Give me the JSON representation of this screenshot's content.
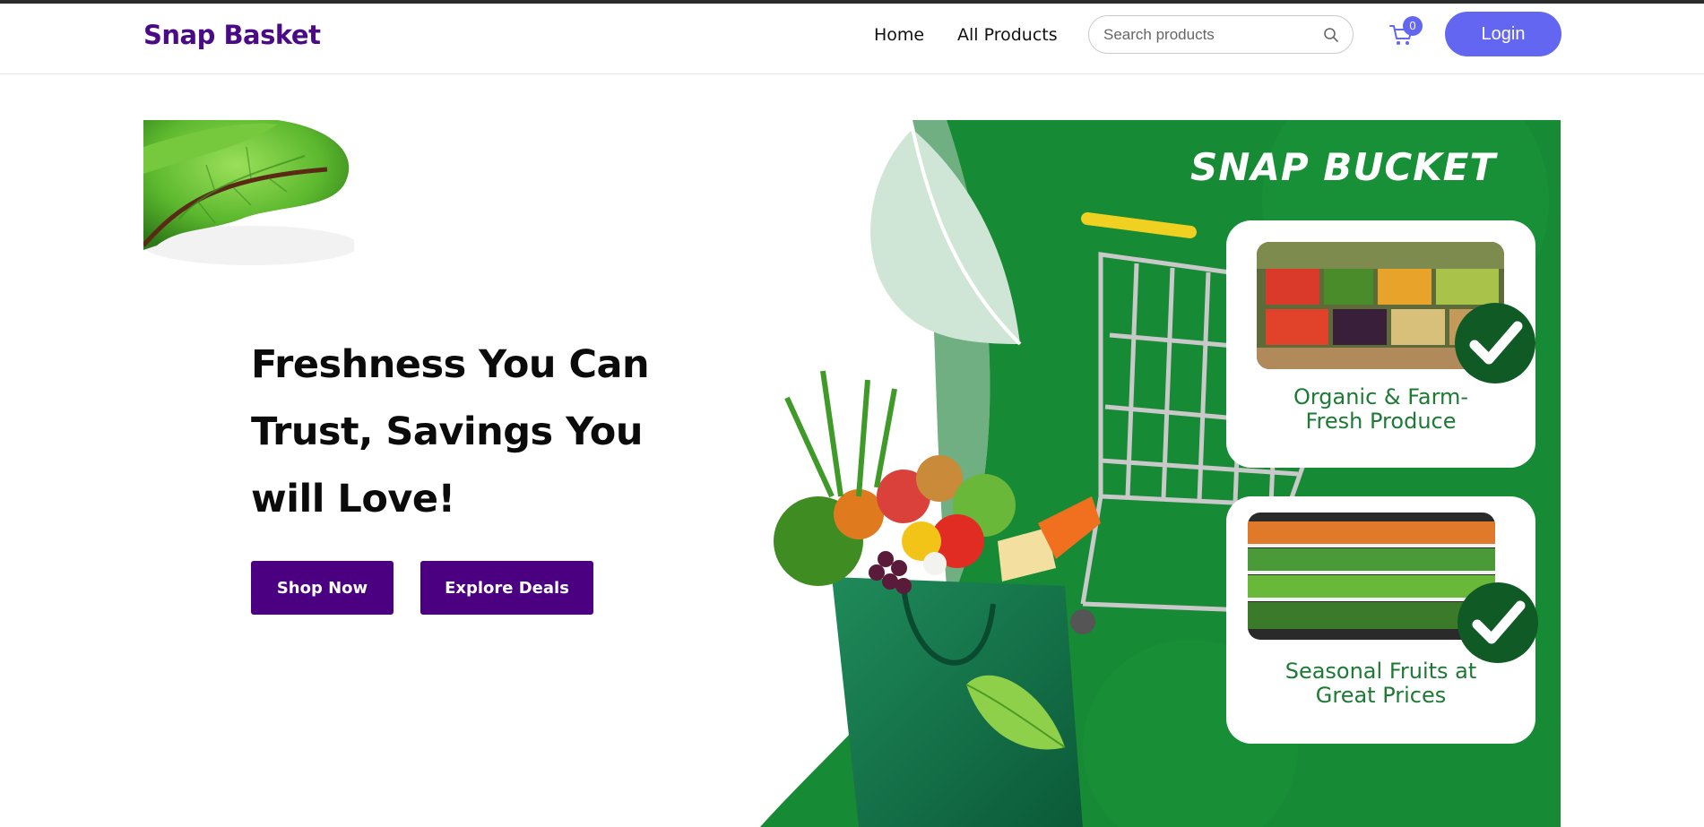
{
  "header": {
    "logo": "Snap Basket",
    "nav": {
      "home": "Home",
      "all_products": "All Products"
    },
    "search": {
      "placeholder": "Search products",
      "value": ""
    },
    "cart_count": "0",
    "login_label": "Login"
  },
  "hero": {
    "title_lines": [
      "Freshness You Can",
      "Trust, Savings You",
      "will Love!"
    ],
    "shop_button": "Shop Now",
    "deals_button": "Explore Deals"
  },
  "banner": {
    "title": "SNAP BUCKET",
    "cards": [
      {
        "lines": [
          "Organic & Farm-",
          "Fresh Produce"
        ]
      },
      {
        "lines": [
          "Seasonal Fruits at",
          "Great Prices"
        ]
      }
    ]
  },
  "colors": {
    "brand": "#4a0a86",
    "accent": "#6366f1",
    "button": "#4b0082",
    "banner_green": "#178a35",
    "card_text": "#1d7a34"
  }
}
